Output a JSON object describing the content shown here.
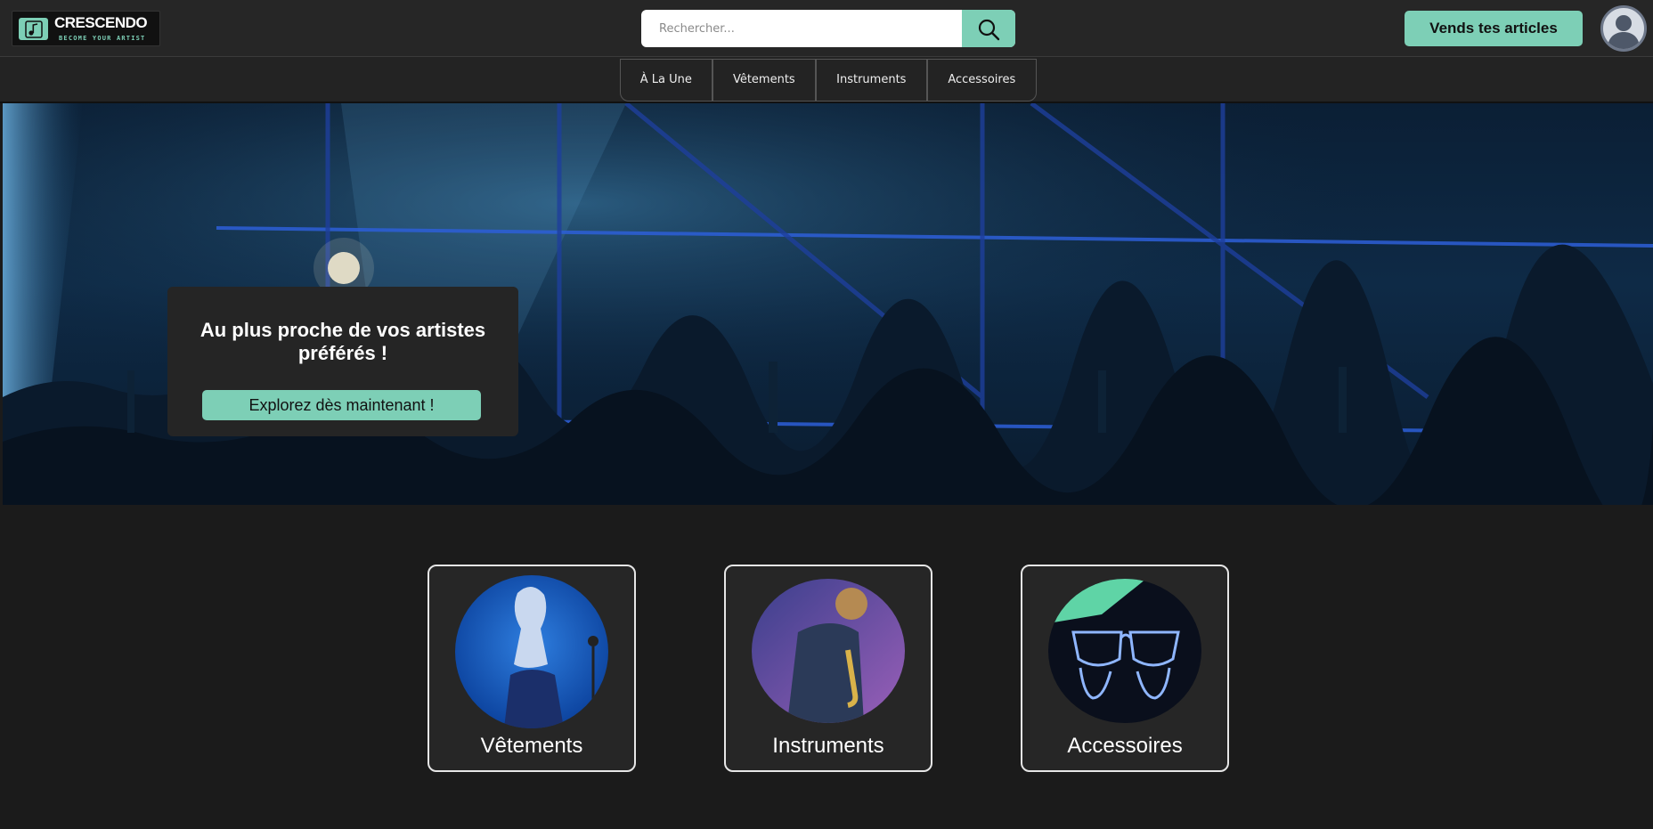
{
  "brand": {
    "name": "CRESCENDO",
    "tagline": "BECOME YOUR ARTIST"
  },
  "search": {
    "placeholder": "Rechercher..."
  },
  "header": {
    "sell_label": "Vends tes articles"
  },
  "nav": {
    "items": [
      {
        "label": "À La Une"
      },
      {
        "label": "Vêtements"
      },
      {
        "label": "Instruments"
      },
      {
        "label": "Accessoires"
      }
    ]
  },
  "hero": {
    "title": "Au plus proche de vos artistes préférés !",
    "cta_label": "Explorez dès maintenant !"
  },
  "categories": [
    {
      "label": "Vêtements",
      "image": "singer-photo"
    },
    {
      "label": "Instruments",
      "image": "saxophonist-photo"
    },
    {
      "label": "Accessoires",
      "image": "neon-glasses-photo"
    }
  ],
  "colors": {
    "accent": "#7dcfb6",
    "background": "#1b1b1b",
    "header": "#262626"
  }
}
